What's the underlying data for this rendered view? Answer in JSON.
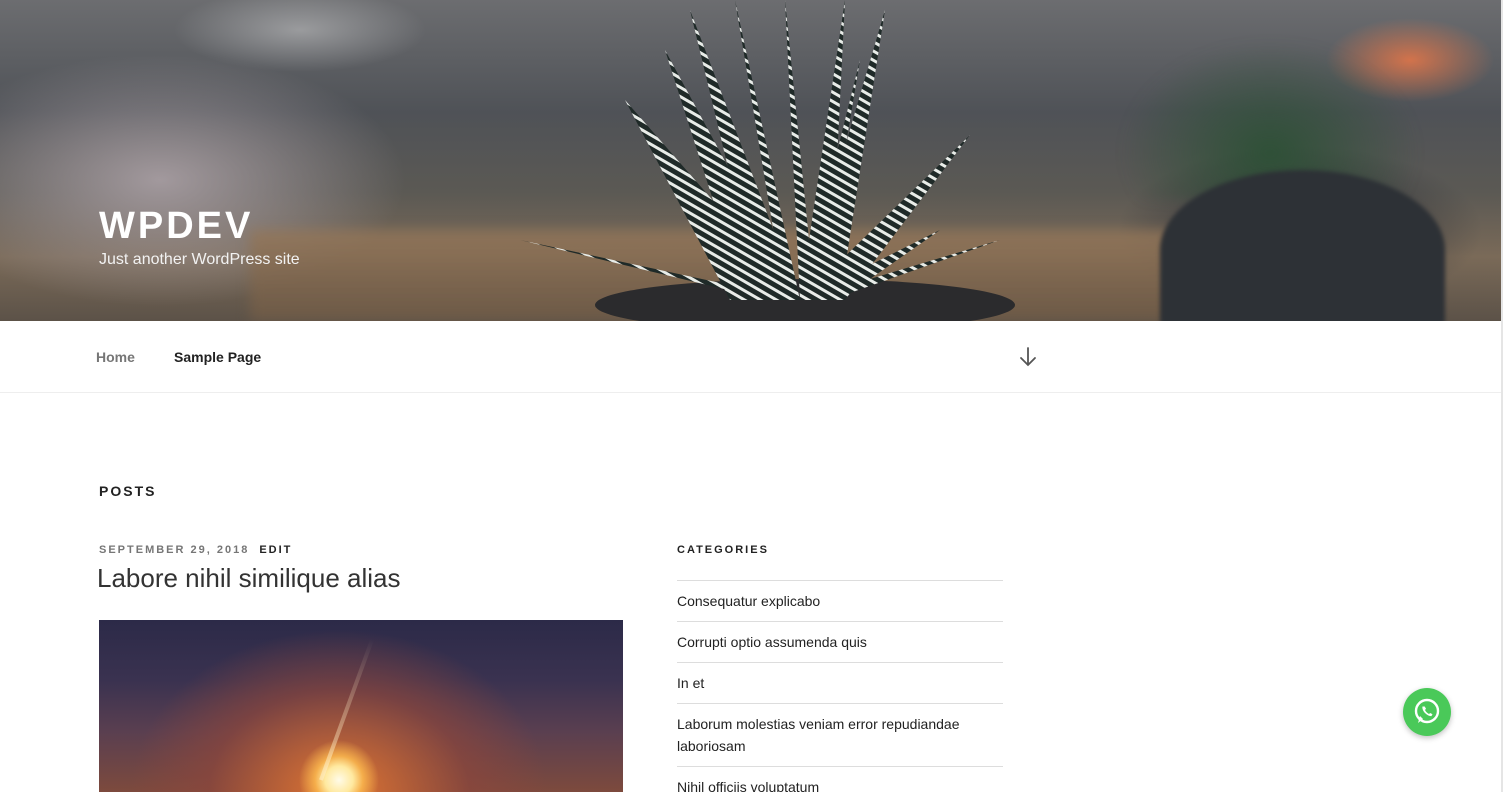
{
  "header": {
    "site_title": "WPDEV",
    "site_description": "Just another WordPress site"
  },
  "nav": {
    "items": [
      {
        "label": "Home"
      },
      {
        "label": "Sample Page"
      }
    ],
    "scroll_icon": "arrow-down-icon"
  },
  "main": {
    "heading": "POSTS",
    "post": {
      "date": "SEPTEMBER 29, 2018",
      "edit_label": "EDIT",
      "title": "Labore nihil similique alias"
    }
  },
  "sidebar": {
    "categories_title": "CATEGORIES",
    "categories": [
      {
        "label": "Consequatur explicabo"
      },
      {
        "label": "Corrupti optio assumenda quis"
      },
      {
        "label": "In et"
      },
      {
        "label": "Laborum molestias veniam error repudiandae laboriosam"
      },
      {
        "label": "Nihil officiis voluptatum"
      }
    ]
  },
  "floating": {
    "whatsapp_icon": "whatsapp-icon",
    "whatsapp_color": "#4ac959"
  }
}
